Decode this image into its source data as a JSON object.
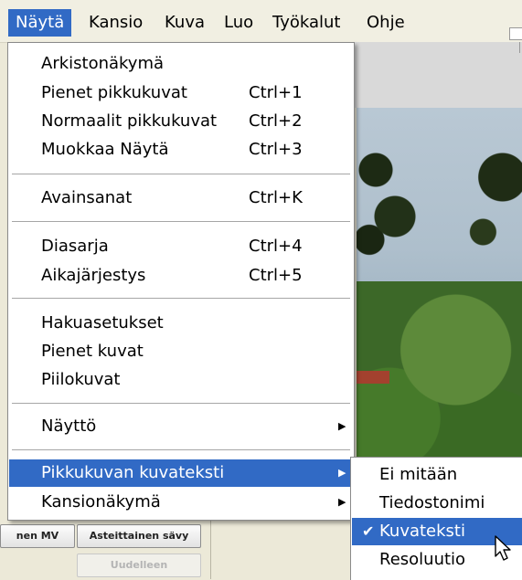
{
  "menubar": {
    "items": [
      {
        "label": "Näytä",
        "active": true
      },
      {
        "label": "Kansio"
      },
      {
        "label": "Kuva"
      },
      {
        "label": "Luo"
      },
      {
        "label": "Työkalut"
      },
      {
        "label": "Ohje"
      }
    ]
  },
  "menu": {
    "groups": [
      [
        {
          "label": "Arkistonäkymä",
          "shortcut": ""
        },
        {
          "label": "Pienet pikkukuvat",
          "shortcut": "Ctrl+1"
        },
        {
          "label": "Normaalit pikkukuvat",
          "shortcut": "Ctrl+2"
        },
        {
          "label": "Muokkaa Näytä",
          "shortcut": "Ctrl+3"
        }
      ],
      [
        {
          "label": "Avainsanat",
          "shortcut": "Ctrl+K"
        }
      ],
      [
        {
          "label": "Diasarja",
          "shortcut": "Ctrl+4"
        },
        {
          "label": "Aikajärjestys",
          "shortcut": "Ctrl+5"
        }
      ],
      [
        {
          "label": "Hakuasetukset",
          "shortcut": ""
        },
        {
          "label": "Pienet kuvat",
          "shortcut": ""
        },
        {
          "label": "Piilokuvat",
          "shortcut": ""
        }
      ],
      [
        {
          "label": "Näyttö",
          "submenu": true
        }
      ],
      [
        {
          "label": "Pikkukuvan kuvateksti",
          "submenu": true,
          "highlighted": true
        },
        {
          "label": "Kansionäkymä",
          "submenu": true
        }
      ]
    ]
  },
  "submenu": {
    "items": [
      {
        "label": "Ei mitään",
        "checked": false
      },
      {
        "label": "Tiedostonimi",
        "checked": false
      },
      {
        "label": "Kuvateksti",
        "checked": true,
        "highlighted": true
      },
      {
        "label": "Resoluutio",
        "checked": false
      }
    ]
  },
  "panel": {
    "btn_mv": "nen MV",
    "btn_gradual": "Asteittainen sävy",
    "btn_again": "Uudelleen"
  },
  "colors": {
    "highlight": "#316ac5",
    "menu_bg": "#ffffff"
  }
}
